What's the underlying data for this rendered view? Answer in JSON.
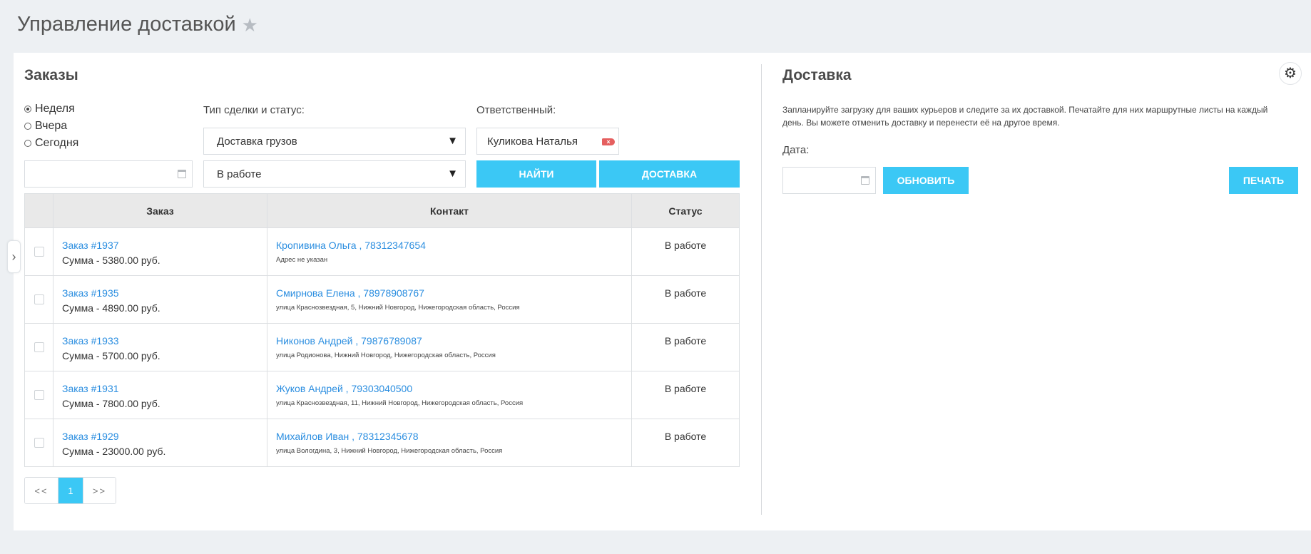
{
  "page": {
    "title": "Управление доставкой",
    "favorite_icon": "star-icon"
  },
  "orders": {
    "title": "Заказы",
    "period": {
      "options": [
        "Неделя",
        "Вчера",
        "Сегодня"
      ],
      "selected": "Неделя"
    },
    "deal_type_label": "Тип сделки и статус:",
    "deal_type_value": "Доставка грузов",
    "status_value": "В работе",
    "responsible_label": "Ответственный:",
    "responsible_value": "Куликова Наталья",
    "find_button": "НАЙТИ",
    "delivery_button": "ДОСТАВКА",
    "table": {
      "headers": [
        "Заказ",
        "Контакт",
        "Статус"
      ],
      "rows": [
        {
          "order": "Заказ #1937",
          "sum": "Сумма - 5380.00 руб.",
          "contact": "Кропивина Ольга , 78312347654",
          "address": "Адрес не указан",
          "status": "В работе"
        },
        {
          "order": "Заказ #1935",
          "sum": "Сумма - 4890.00 руб.",
          "contact": "Смирнова Елена , 78978908767",
          "address": "улица Краснозвездная, 5, Нижний Новгород, Нижегородская область, Россия",
          "status": "В работе"
        },
        {
          "order": "Заказ #1933",
          "sum": "Сумма - 5700.00 руб.",
          "contact": "Никонов Андрей , 79876789087",
          "address": "улица Родионова, Нижний Новгород, Нижегородская область, Россия",
          "status": "В работе"
        },
        {
          "order": "Заказ #1931",
          "sum": "Сумма - 7800.00 руб.",
          "contact": "Жуков Андрей , 79303040500",
          "address": "улица Краснозвездная, 11, Нижний Новгород, Нижегородская область, Россия",
          "status": "В работе"
        },
        {
          "order": "Заказ #1929",
          "sum": "Сумма - 23000.00 руб.",
          "contact": "Михайлов Иван , 78312345678",
          "address": "улица Вологдина, 3, Нижний Новгород, Нижегородская область, Россия",
          "status": "В работе"
        }
      ]
    },
    "pagination": {
      "prev": "<<",
      "current": "1",
      "next": ">>"
    }
  },
  "delivery": {
    "title": "Доставка",
    "description": "Запланируйте загрузку для ваших курьеров и следите за их доставкой. Печатайте для них маршрутные листы на каждый день. Вы можете отменить доставку и перенести её на другое время.",
    "date_label": "Дата:",
    "refresh_button": "ОБНОВИТЬ",
    "print_button": "ПЕЧАТЬ",
    "settings_icon": "gear-icon"
  },
  "colors": {
    "accent": "#3bc8f5",
    "link": "#2b8ee0",
    "remove": "#e55f5f"
  }
}
